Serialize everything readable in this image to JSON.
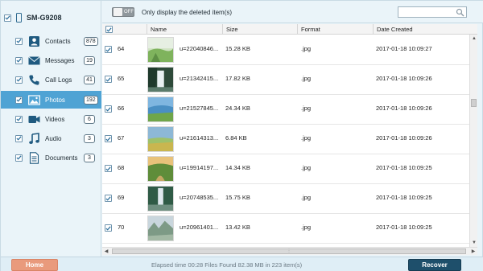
{
  "device": {
    "name": "SM-G9208",
    "checked": true
  },
  "categories": [
    {
      "label": "Contacts",
      "count": "878",
      "icon": "contacts-icon"
    },
    {
      "label": "Messages",
      "count": "19",
      "icon": "envelope-icon"
    },
    {
      "label": "Call Logs",
      "count": "41",
      "icon": "phone-handset-icon"
    },
    {
      "label": "Photos",
      "count": "192",
      "icon": "photo-icon",
      "selected": true
    },
    {
      "label": "Videos",
      "count": "6",
      "icon": "video-camera-icon"
    },
    {
      "label": "Audio",
      "count": "3",
      "icon": "music-note-icon"
    },
    {
      "label": "Documents",
      "count": "3",
      "icon": "document-icon"
    }
  ],
  "filter": {
    "toggle_text": "OFF",
    "label": "Only display the deleted item(s)"
  },
  "search": {
    "placeholder": ""
  },
  "table": {
    "columns": [
      "Name",
      "Size",
      "Format",
      "Date Created"
    ],
    "rows": [
      {
        "id": "64",
        "name": "u=22040846...",
        "size": "15.28 KB",
        "format": ".jpg",
        "date": "2017-01-18 10:09:27"
      },
      {
        "id": "65",
        "name": "u=21342415...",
        "size": "17.82 KB",
        "format": ".jpg",
        "date": "2017-01-18 10:09:26"
      },
      {
        "id": "66",
        "name": "u=21527845...",
        "size": "24.34 KB",
        "format": ".jpg",
        "date": "2017-01-18 10:09:26"
      },
      {
        "id": "67",
        "name": "u=21614313...",
        "size": "6.84 KB",
        "format": ".jpg",
        "date": "2017-01-18 10:09:26"
      },
      {
        "id": "68",
        "name": "u=19914197...",
        "size": "14.34 KB",
        "format": ".jpg",
        "date": "2017-01-18 10:09:25"
      },
      {
        "id": "69",
        "name": "u=20748535...",
        "size": "15.75 KB",
        "format": ".jpg",
        "date": "2017-01-18 10:09:25"
      },
      {
        "id": "70",
        "name": "u=20961401...",
        "size": "13.42 KB",
        "format": ".jpg",
        "date": "2017-01-18 10:09:25"
      }
    ]
  },
  "footer": {
    "home_label": "Home",
    "status": "Elapsed time 00:28   Files Found 82.38 MB in 223 item(s)",
    "recover_label": "Recover"
  },
  "colors": {
    "selected_bg": "#4fa3d4",
    "recover_bg": "#1e4f6b",
    "home_bg": "#e99a7c",
    "sidebar_bg": "#eaf4f9",
    "icon_blue": "#1f5a80"
  }
}
